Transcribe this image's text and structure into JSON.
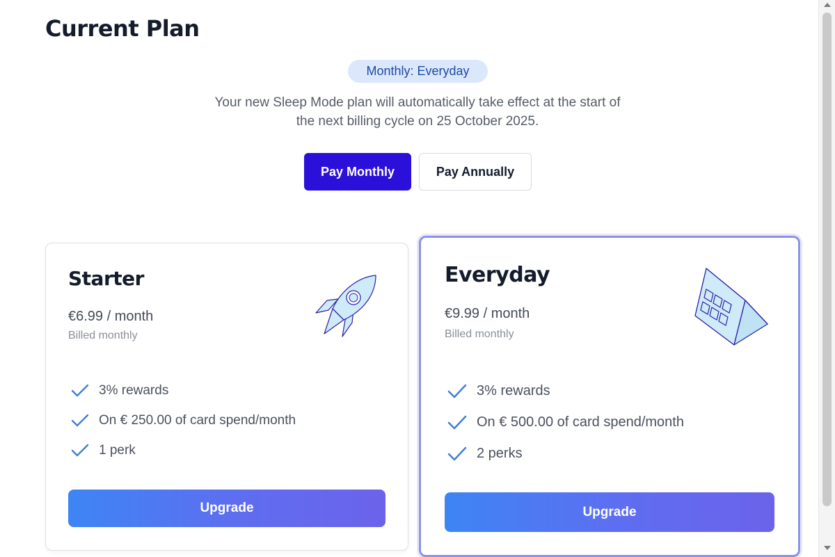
{
  "page": {
    "title": "Current Plan"
  },
  "badge": {
    "label": "Monthly: Everyday"
  },
  "notice": {
    "line1": "Your new Sleep Mode plan will automatically take effect at the start of",
    "line2": "the next billing cycle on 25 October 2025."
  },
  "billing_toggle": {
    "monthly_label": "Pay Monthly",
    "annually_label": "Pay Annually",
    "selected": "monthly"
  },
  "plans": [
    {
      "name": "Starter",
      "price": "€6.99 / month",
      "billed": "Billed monthly",
      "icon": "rocket-icon",
      "features": [
        "3% rewards",
        "On € 250.00 of card spend/month",
        "1 perk"
      ],
      "button_label": "Upgrade"
    },
    {
      "name": "Everyday",
      "price": "€9.99 / month",
      "billed": "Billed monthly",
      "icon": "calendar-icon",
      "features": [
        "3% rewards",
        "On € 500.00 of card spend/month",
        "2 perks"
      ],
      "button_label": "Upgrade",
      "current": true
    }
  ],
  "colors": {
    "accent": "#2a10d8",
    "badge_bg": "#dbe8fb",
    "badge_text": "#1f4aa8",
    "check": "#3f7fd8",
    "gradient_start": "#3d85f4",
    "gradient_end": "#6b63ea",
    "illustration_fill": "#cfeaf8",
    "illustration_stroke": "#2c1fa8"
  }
}
